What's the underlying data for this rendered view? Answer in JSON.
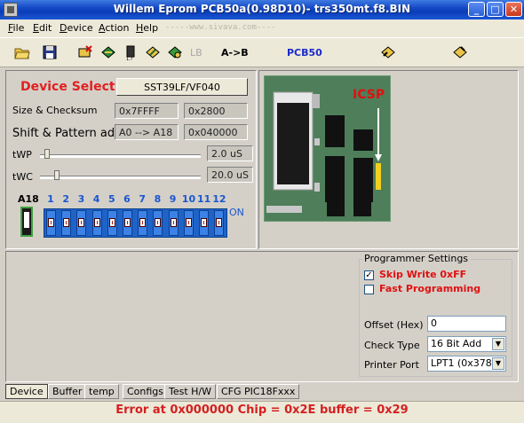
{
  "window": {
    "title": "Willem Eprom PCB50a(0.98D10)- trs350mt.f8.BIN"
  },
  "titlebar_buttons": {
    "minimize": "_",
    "maximize": "□",
    "close": "✕"
  },
  "menu": {
    "items": [
      "File",
      "Edit",
      "Device",
      "Action",
      "Help"
    ],
    "watermark": "-----www.sivava.com----"
  },
  "toolbar": {
    "lb": "LB",
    "a_to_b": "A->B",
    "pcb50": "PCB50"
  },
  "device": {
    "select_label": "Device Select",
    "selected": "SST39LF/VF040"
  },
  "size_checksum": {
    "label": "Size & Checksum",
    "size": "0x7FFFF",
    "checksum": "0x2800"
  },
  "shift_pattern": {
    "label": "Shift & Pattern adr",
    "shift": "A0 --> A18",
    "pattern": "0x040000"
  },
  "timing": {
    "twp_label": "tWP",
    "twp_value": "2.0 uS",
    "twc_label": "tWC",
    "twc_value": "20.0 uS"
  },
  "dip": {
    "a18_label": "A18",
    "numbers": [
      "1",
      "2",
      "3",
      "4",
      "5",
      "6",
      "7",
      "8",
      "9",
      "10",
      "11",
      "12"
    ],
    "on_label": "ON"
  },
  "board": {
    "icsp_label": "ICSP"
  },
  "settings": {
    "legend": "Programmer Settings",
    "skip_write": "Skip Write 0xFF",
    "skip_write_checked": true,
    "fast_programming": "Fast Programming",
    "fast_programming_checked": false,
    "offset_label": "Offset (Hex)",
    "offset_value": "0",
    "check_type_label": "Check Type",
    "check_type_value": "16 Bit Add",
    "printer_port_label": "Printer Port",
    "printer_port_value": "LPT1 (0x378)"
  },
  "tabs": [
    "Device",
    "Buffer",
    "temp",
    "Configs",
    "Test H/W",
    "CFG PIC18Fxxx"
  ],
  "status": {
    "text": "Error at 0x000000  Chip = 0x2E  buffer = 0x29"
  }
}
